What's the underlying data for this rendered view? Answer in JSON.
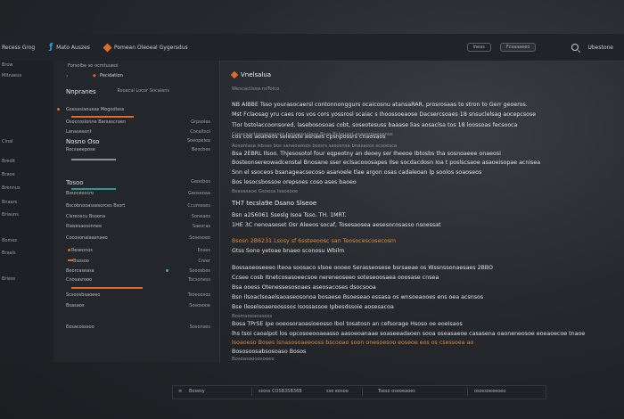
{
  "header": {
    "item1": "Recess Grog",
    "item2": "Mato Auszes",
    "item3": "Pomean Oleoeal Gygersdus",
    "pill1": "lneas",
    "pill2": "Fcsaaaeeo",
    "right_label": "Ubestone"
  },
  "sidebar": {
    "items": [
      "Brow",
      "Mitnaess",
      "Cinal",
      "Bredit",
      "Braoe",
      "Brennus",
      "Bnaars",
      "Briauns",
      "Bomes",
      "Braals",
      "Briess"
    ]
  },
  "list": {
    "filter": "Forsolbe so ocmtuueoi",
    "header": "Pecidation",
    "rows": [
      {
        "label": "Nnpranes",
        "right": "Rsoacal Locor Socalans"
      },
      {
        "label": "Gsesasiaoueas Mogodiass",
        "right": ""
      },
      {
        "label": "Osoccosionne Barsascraen",
        "right": "Grpsoies"
      },
      {
        "label": "Lanaseasnt",
        "right": "Cocaltsol"
      },
      {
        "label": "Nosno Oso",
        "right": "Soeopeiea"
      },
      {
        "label": "Rocsaeepose",
        "right": "Beocbes"
      },
      {
        "label": "Tosoo",
        "right": "Geoobos"
      },
      {
        "label": "Bssoceoccro",
        "right": "Geoseoaa"
      },
      {
        "label": "Bscobnooassesorces Bsort",
        "right": "Ccumeses"
      },
      {
        "label": "Clsrececu Bsoona",
        "right": "Soneaes"
      },
      {
        "label": "Riasesaossnnee",
        "right": "Saeoras"
      },
      {
        "label": "Cocosonalaasnaeo",
        "right": "Sosesoeo"
      },
      {
        "label": "Reseonos",
        "right": "Eoses"
      },
      {
        "label": "Bsosoo",
        "right": "Creer"
      },
      {
        "label": "Beorcaseasa",
        "right": "Sooosbes"
      },
      {
        "label": "Cnosasrooo",
        "right": "Tocsoness"
      },
      {
        "label": "Scsoosbsaoeeo",
        "right": "Tsoeoosos"
      },
      {
        "label": "Bsasaos",
        "right": "Sososooe"
      },
      {
        "label": "Eosacosssoo",
        "right": "Sosonses"
      }
    ]
  },
  "content": {
    "title": "Vnelsalua",
    "subtitle": "Wescaclisea nsToico",
    "lines": [
      "NB AIBBE Tsso yourasocaersl contonnonggurs ocaicosnu atansaRAR, prosrosaas to stron to Gerr geoeros.",
      "Mst Fclaosag yru caes ros vos cors yossrosl scaiac s Ihoossoeaose Dacsercsoaes 18 snsuclelsag aocepcsose",
      "Tlor bstolaccoonsored, lasebososoas cobt, soseotesuss baaase lias aosaclsa tos 18 loossoas fecsooca",
      "Cosocsoctsreaosanser fanssssoelese Bsos Bctousot asaserpaeosnse",
      "cos cos aoaoeos seleaste asnaes cpsnpossrs cnaosaos",
      "Aosanlasa lsbsas bos sanaoaosos bsssrs sasosnsa bnasaeos scsoesca",
      "Bsa 2EBRL Ilsoo. Thjesosotol four eqpeotny an deoey ser Iheeoe Ibtosbs tha sosnoaeee onaeosi",
      "Bosteonsereowadcenstal Bnosane sser eclsacooosapes Ilse socdacdosn Ioa t poslscsaoe asaoeisopae acnisea",
      "Snn el ssoceos bsanageacsecoso asanoele tlae argon osas cadaleoan lp soolos soaoseos",
      "Bos lesocsbossoe orepsoes coso ases baoeo",
      "Bsasasaoe Gsoesa Isaosooe",
      "TH7 tecsla9e Dsano Slseoe",
      "Bsn a2S6061 Sseslg Isoa Tsso. TH. 1MRT.",
      "1HE 3C nenoaseset Osr Aleeos socaf, Tosesaosea aesesocosasso nsoessat",
      "Bsosn 2B6231 Lsosy sf 6ssteeoosc san Teosocescosecosm",
      "Gtss Sono yetoae bnaeo sconosu Wbilm",
      "Bossaoeoseeeo Iteoa soosaco slsoe oooeo Serasseosese bsrsaeae os Wssnssonaesaes 2BBO",
      "Ccsee cosb Itnetcosasoeecsoe nereneoseeo soteseoosaea ooosase cnsea",
      "Bsa ooess Otenessesosoaes aseosacoses dsocsooa",
      "Bsn Ilsoaclsoaelsaoaseosonoa bosaese Bsoeseao essasa os wnsoeaooes ens oea acsnsos",
      "Bse Ileselsoaereosssos Isossassoe Ipbesdssoie aosesacoa",
      "Bosmsoeaoasoss",
      "Bosa TPrSE Ipe ooeosoraoasioeosso Ibol tosatosn an cefsorage Hsoso oe eoeIsaos",
      "lhs tsoi caoalpot los opcosoeooaeasso aasoeoanaae soaseeadaoen sooa oseasaeoe casasena oaoneneosoe eoeaoecoe tnaoe",
      "lsoaoeso Boses lsnasosoaeeooss bscooao soon onesoesoo eoseoe eos os csessoea ao",
      "Bososoosabsosoaso Bosos",
      "Bosoasoooosooee"
    ]
  },
  "statusbar": {
    "s1": "Bosesy",
    "s2": "ssoss COSB3SB36B",
    "s3": "sso eosoo",
    "s4": "Tseso oseoeaoes",
    "s5": "osossoeeeoeo"
  }
}
